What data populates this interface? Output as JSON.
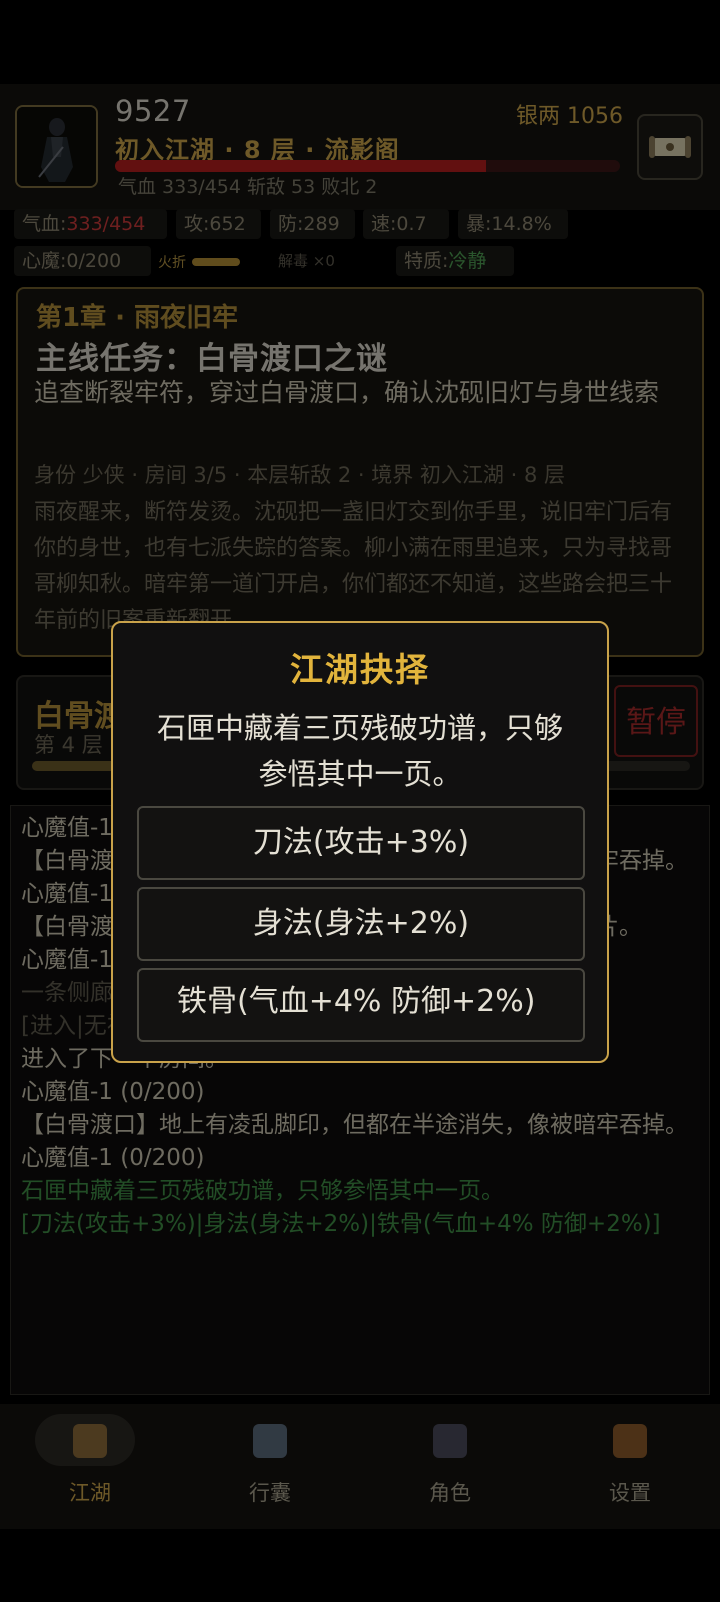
{
  "header": {
    "player_name": "9527",
    "silver": "银两 1056",
    "realm": "初入江湖 · 8 层 · 流影阁",
    "hp_fraction": 0.735,
    "stats_line": "气血 333/454   斩敌 53   败北 2"
  },
  "chips": {
    "hp_label": "气血:",
    "hp_value": "333/454",
    "atk": "攻:652",
    "def": "防:289",
    "spd": "速:0.7",
    "crit": "暴:14.8%",
    "demon": "心魔:0/200",
    "fire_label": "火折",
    "antidote": "解毒 ×0",
    "trait_label": "特质:",
    "trait_value": "冷静"
  },
  "chapter": {
    "title": "第1章 · 雨夜旧牢",
    "quest": "主线任务：白骨渡口之谜",
    "desc": "追查断裂牢符，穿过白骨渡口，确认沈砚旧灯与身世线索",
    "meta": "身份 少侠 · 房间 3/5 · 本层斩敌 2 · 境界 初入江湖 · 8 层",
    "story": "雨夜醒来，断符发烫。沈砚把一盏旧灯交到你手里，说旧牢门后有你的身世，也有七派失踪的答案。柳小满在雨里追来，只为寻找哥哥柳知秋。暗牢第一道门开启，你们都还不知道，这些路会把三十年前的旧案重新翻开。"
  },
  "boss": {
    "name": "白骨渡口",
    "floor": "第 4 层",
    "progress": 0.21,
    "pause_label": "暂停"
  },
  "log": [
    {
      "text": "心魔值-1 (0/200)",
      "style": "normal"
    },
    {
      "text": "【白骨渡口】地上有凌乱脚印，但都在半途消失，像被暗牢吞掉。",
      "style": "normal"
    },
    {
      "text": "心魔值-1 (0/200)",
      "style": "normal"
    },
    {
      "text": "【白骨渡口】墙角有人留下的记号，旁边是几枚踩碎的瓦片。",
      "style": "normal"
    },
    {
      "text": "心魔值-1 (0/200)",
      "style": "normal"
    },
    {
      "text": "一条侧廊里，墙上的血字被雨水冲淡，只剩下一抹暗红。",
      "style": "dim"
    },
    {
      "text": "[进入|无视]",
      "style": "dim"
    },
    {
      "text": "进入了下一个房间。",
      "style": "normal"
    },
    {
      "text": "心魔值-1 (0/200)",
      "style": "normal"
    },
    {
      "text": "【白骨渡口】地上有凌乱脚印，但都在半途消失，像被暗牢吞掉。",
      "style": "normal"
    },
    {
      "text": "心魔值-1 (0/200)",
      "style": "normal"
    },
    {
      "text": "石匣中藏着三页残破功谱，只够参悟其中一页。",
      "style": "green"
    },
    {
      "text": "[刀法(攻击+3%)|身法(身法+2%)|铁骨(气血+4% 防御+2%)]",
      "style": "green"
    }
  ],
  "nav": [
    {
      "label": "江湖",
      "icon": "pagoda-icon",
      "active": true,
      "color": "#8a6a3a"
    },
    {
      "label": "行囊",
      "icon": "bag-icon",
      "active": false,
      "color": "#5a6a7a"
    },
    {
      "label": "角色",
      "icon": "character-icon",
      "active": false,
      "color": "#4a4a5a"
    },
    {
      "label": "设置",
      "icon": "scroll-settings-icon",
      "active": false,
      "color": "#8a5a2a"
    }
  ],
  "modal": {
    "title": "江湖抉择",
    "message": "石匣中藏着三页残破功谱，只够参悟其中一页。",
    "options": [
      "刀法(攻击+3%)",
      "身法(身法+2%)",
      "铁骨(气血+4% 防御+2%)"
    ]
  },
  "colors": {
    "accent_gold": "#c9a24a",
    "hp_red": "#b31e1e",
    "green_text": "#3f8d45",
    "modal_border": "#c9a24a"
  }
}
